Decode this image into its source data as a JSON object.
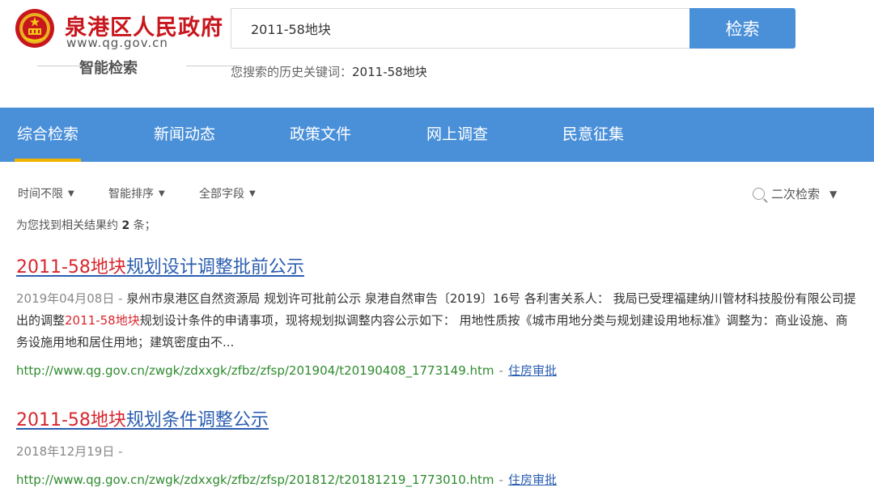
{
  "header": {
    "site_name": "泉港区人民政府",
    "site_url": "www.qg.gov.cn",
    "search_label": "智能检索",
    "search_value": "2011-58地块",
    "search_button": "检索",
    "history_prefix": "您搜索的历史关键词：",
    "history_keyword": "2011-58地块",
    "emblem_icon": "national-emblem-icon",
    "brand_color": "#c8161d"
  },
  "nav": {
    "accent_color": "#4a90d9",
    "tabs": [
      {
        "label": "综合检索",
        "active": true
      },
      {
        "label": "新闻动态",
        "active": false
      },
      {
        "label": "政策文件",
        "active": false
      },
      {
        "label": "网上调查",
        "active": false
      },
      {
        "label": "民意征集",
        "active": false
      }
    ]
  },
  "filters": {
    "time": "时间不限",
    "sort": "智能排序",
    "field": "全部字段",
    "secondary_search": "二次检索"
  },
  "results_summary": {
    "prefix": "为您找到相关结果约",
    "count": "2",
    "suffix": "条；"
  },
  "results": [
    {
      "title_highlight": "2011-58地块",
      "title_rest": "规划设计调整批前公示",
      "date": "2019年04月08日 -",
      "snippet_before": "泉州市泉港区自然资源局 规划许可批前公示 泉港自然审告〔2019〕16号 各利害关系人： 我局已受理福建纳川管材科技股份有限公司提出的调整",
      "snippet_highlight": "2011-58地块",
      "snippet_after": "规划设计条件的申请事项，现将规划拟调整内容公示如下： 用地性质按《城市用地分类与规划建设用地标准》调整为：商业设施、商务设施用地和居住用地；建筑密度由不...",
      "url": "http://www.qg.gov.cn/zwgk/zdxxgk/zfbz/zfsp/201904/t20190408_1773149.htm",
      "separator": "-",
      "category": "住房审批"
    },
    {
      "title_highlight": "2011-58地块",
      "title_rest": "规划条件调整公示",
      "date": "2018年12月19日 -",
      "url": "http://www.qg.gov.cn/zwgk/zdxxgk/zfbz/zfsp/201812/t20181219_1773010.htm",
      "separator": "-",
      "category": "住房审批"
    }
  ]
}
